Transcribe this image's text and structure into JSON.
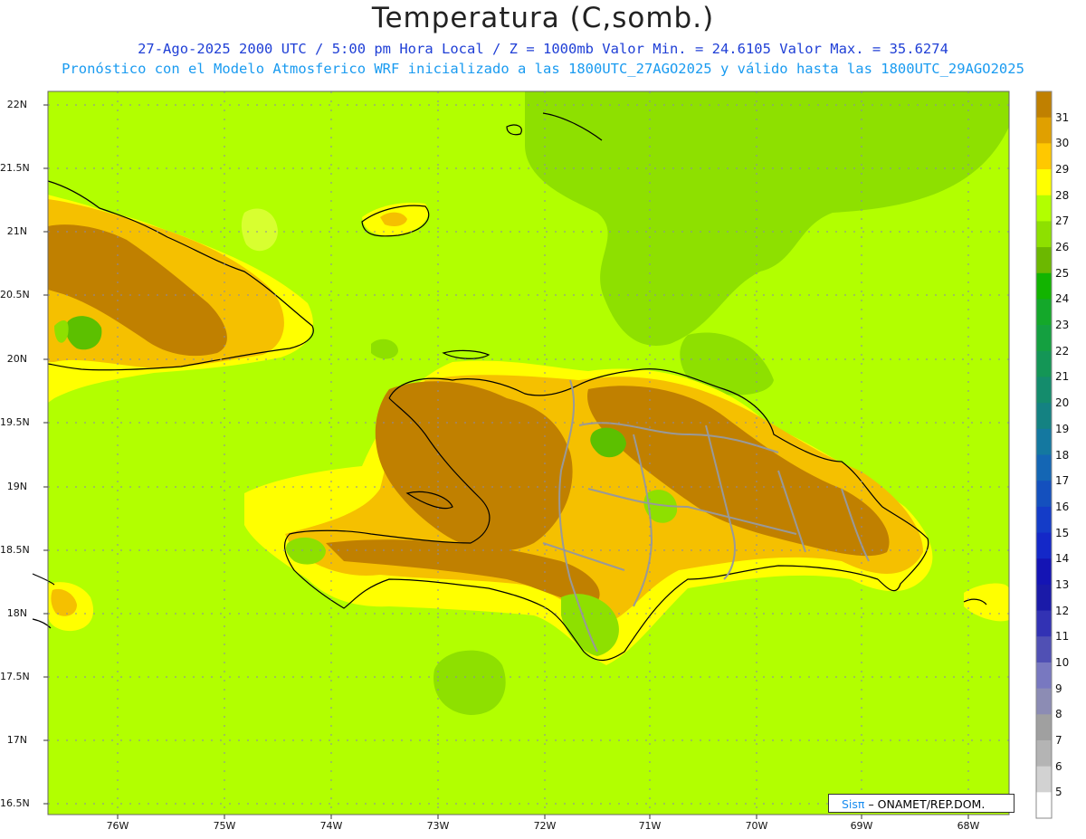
{
  "header": {
    "title": "Temperatura (C,somb.)",
    "line1": "27-Ago-2025  2000 UTC / 5:00 pm Hora Local / Z = 1000mb   Valor Min. = 24.6105  Valor Max. = 35.6274",
    "line2": "Pronóstico con el Modelo Atmosferico WRF inicializado a las 1800UTC_27AGO2025 y válido hasta las  1800UTC_29AGO2025"
  },
  "map": {
    "lat_labels": [
      "22N",
      "21.5N",
      "21N",
      "20.5N",
      "20N",
      "19.5N",
      "19N",
      "18.5N",
      "18N",
      "17.5N",
      "17N",
      "16.5N"
    ],
    "lon_labels": [
      "76W",
      "75W",
      "74W",
      "73W",
      "72W",
      "71W",
      "70W",
      "69W",
      "68W"
    ],
    "field_colors": {
      "base": "#b2ff00",
      "t27": "#8ee000",
      "t29": "#ffff00",
      "t30": "#f5c000",
      "t31": "#c08000",
      "t26": "#5cc000",
      "t25": "#2aa010"
    }
  },
  "colorbar": {
    "labels": [
      "31",
      "30",
      "29",
      "28",
      "27",
      "26",
      "25",
      "24",
      "23",
      "22",
      "21",
      "20",
      "19",
      "18",
      "17",
      "16",
      "15",
      "14",
      "13",
      "12",
      "11",
      "10",
      "9",
      "8",
      "7",
      "6",
      "5"
    ],
    "colors": [
      "#c08000",
      "#e0a000",
      "#ffc800",
      "#ffff00",
      "#b2ff00",
      "#8ee000",
      "#6cb800",
      "#12b400",
      "#14a82a",
      "#14a040",
      "#149656",
      "#148c6c",
      "#148282",
      "#1478a0",
      "#1466b4",
      "#1450be",
      "#143cc8",
      "#1428c8",
      "#1414b4",
      "#1a1aa8",
      "#3232b4",
      "#5050b4",
      "#7878c0",
      "#8c8cb4",
      "#a0a0a0",
      "#b4b4b4",
      "#d2d2d2",
      "#ffffff"
    ]
  },
  "credit": {
    "brand": "Sisπ",
    "text": "– ONAMET/REP.DOM."
  }
}
